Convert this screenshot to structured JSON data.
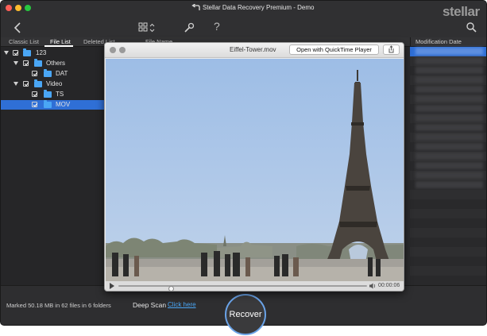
{
  "window": {
    "title": "Stellar Data Recovery Premium - Demo",
    "brand": "stellar",
    "colors": {
      "accent": "#2f6fd6",
      "link": "#4aa6f5",
      "close": "#fc5f57",
      "minimize": "#fdbc2e",
      "zoom": "#28c840"
    }
  },
  "toolbar": {
    "back_icon": "chevron-left-icon",
    "view_icon": "grid-view-icon",
    "tools_icon": "wrench-icon",
    "help_label": "?",
    "search_icon": "search-icon"
  },
  "left_panel": {
    "tabs": [
      {
        "label": "Classic List",
        "active": false
      },
      {
        "label": "File List",
        "active": true
      },
      {
        "label": "Deleted List",
        "active": false
      }
    ],
    "tree": [
      {
        "label": "123",
        "level": 0,
        "expanded": true,
        "checked": true,
        "selected": false
      },
      {
        "label": "Others",
        "level": 1,
        "expanded": true,
        "checked": true,
        "selected": false
      },
      {
        "label": "DAT",
        "level": 2,
        "checked": true,
        "selected": false
      },
      {
        "label": "Video",
        "level": 1,
        "expanded": true,
        "checked": true,
        "selected": false
      },
      {
        "label": "TS",
        "level": 2,
        "checked": true,
        "selected": false
      },
      {
        "label": "MOV",
        "level": 2,
        "checked": true,
        "selected": true
      }
    ]
  },
  "table": {
    "headers": [
      "File Name",
      "Modification Date"
    ]
  },
  "preview": {
    "filename": "Eiffel-Tower.mov",
    "open_button": "Open with QuickTime Player",
    "share_icon": "share-icon",
    "time": "00:00:06",
    "progress": 0.2
  },
  "status": {
    "marked_text": "Marked 50.18 MB in 62 files in 6 folders",
    "deep_scan_label": "Deep Scan",
    "deep_scan_link": "Click here",
    "recover_button": "Recover"
  }
}
